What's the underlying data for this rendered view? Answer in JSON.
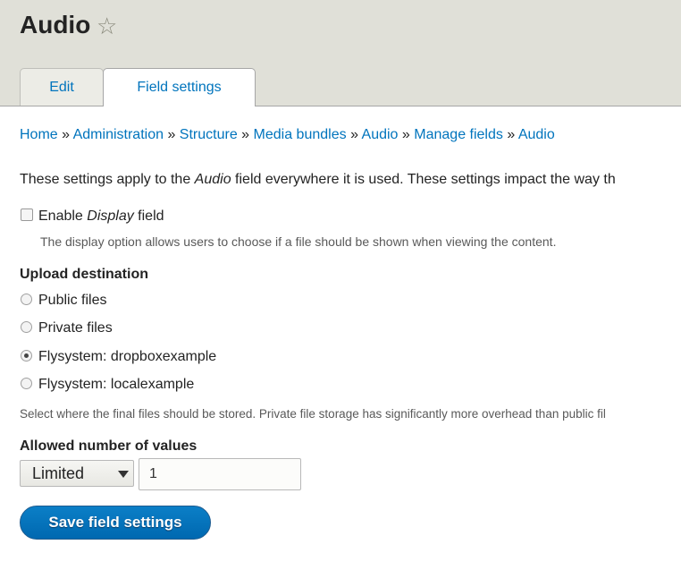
{
  "header": {
    "title": "Audio",
    "star_icon": "star-outline-icon"
  },
  "tabs": [
    {
      "label": "Edit",
      "active": false
    },
    {
      "label": "Field settings",
      "active": true
    }
  ],
  "breadcrumb": [
    "Home",
    "Administration",
    "Structure",
    "Media bundles",
    "Audio",
    "Manage fields",
    "Audio"
  ],
  "breadcrumb_separator": "»",
  "intro": {
    "before": "These settings apply to the ",
    "em": "Audio",
    "after": " field everywhere it is used. These settings impact the way th"
  },
  "display_field": {
    "label_before": "Enable ",
    "label_em": "Display",
    "label_after": " field",
    "checked": false,
    "description": "The display option allows users to choose if a file should be shown when viewing the content."
  },
  "upload_destination": {
    "label": "Upload destination",
    "options": [
      {
        "label": "Public files",
        "selected": false
      },
      {
        "label": "Private files",
        "selected": false
      },
      {
        "label": "Flysystem: dropboxexample",
        "selected": true
      },
      {
        "label": "Flysystem: localexample",
        "selected": false
      }
    ],
    "description": "Select where the final files should be stored. Private file storage has significantly more overhead than public fil"
  },
  "cardinality": {
    "label": "Allowed number of values",
    "select_value": "Limited",
    "number_value": "1"
  },
  "save_button": "Save field settings",
  "colors": {
    "link": "#0074bd",
    "header_bg": "#e0e0d8",
    "button": "#0074bd"
  }
}
